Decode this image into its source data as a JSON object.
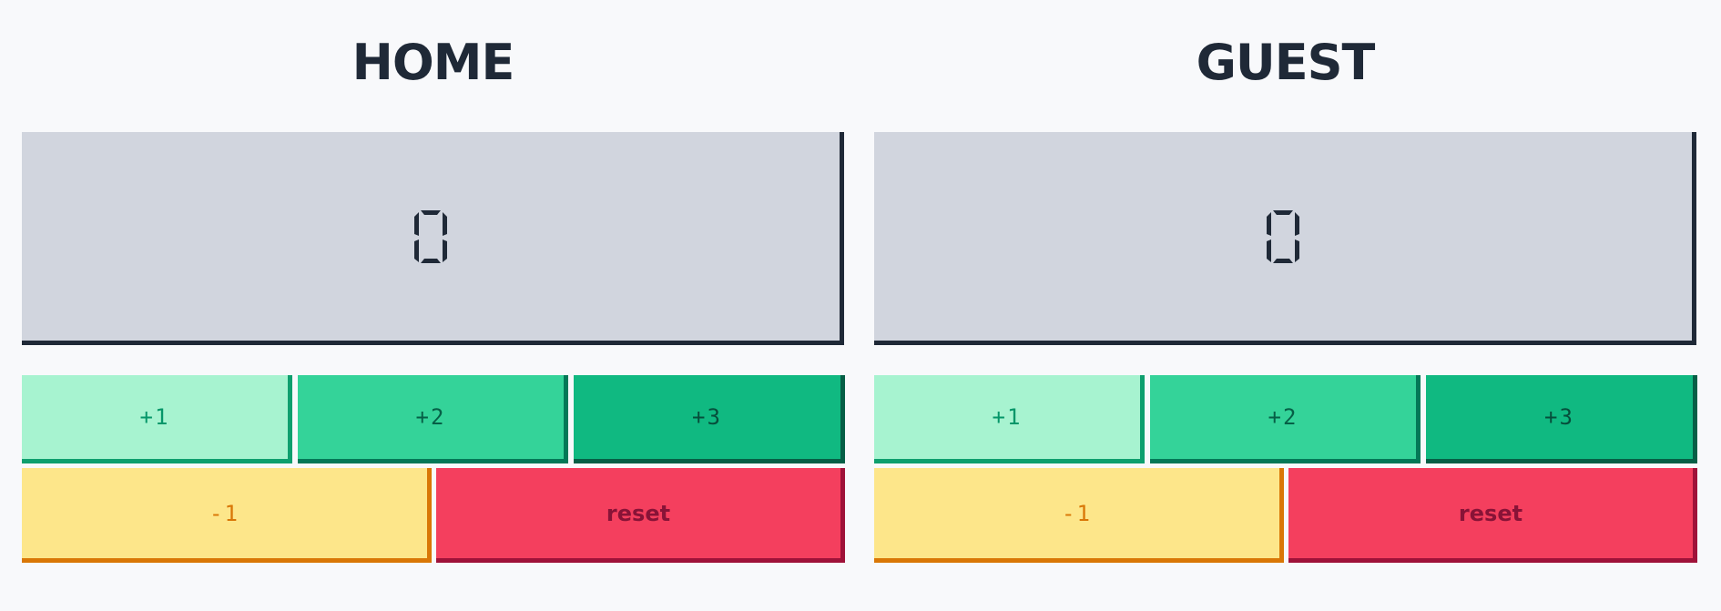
{
  "teams": [
    {
      "name": "HOME",
      "score": "0",
      "buttons": {
        "plus1": "+1",
        "plus2": "+2",
        "plus3": "+3",
        "minus1": "-1",
        "reset": "reset"
      }
    },
    {
      "name": "GUEST",
      "score": "0",
      "buttons": {
        "plus1": "+1",
        "plus2": "+2",
        "plus3": "+3",
        "minus1": "-1",
        "reset": "reset"
      }
    }
  ],
  "colors": {
    "background": "#f8f9fb",
    "title": "#1f2937",
    "score_panel": "#d1d5de",
    "plus1": "#a7f3d0",
    "plus2": "#34d399",
    "plus3": "#10b981",
    "minus1": "#fde68a",
    "reset": "#f43f5e"
  },
  "icons": {
    "score_digit": "seven-segment-digit"
  }
}
